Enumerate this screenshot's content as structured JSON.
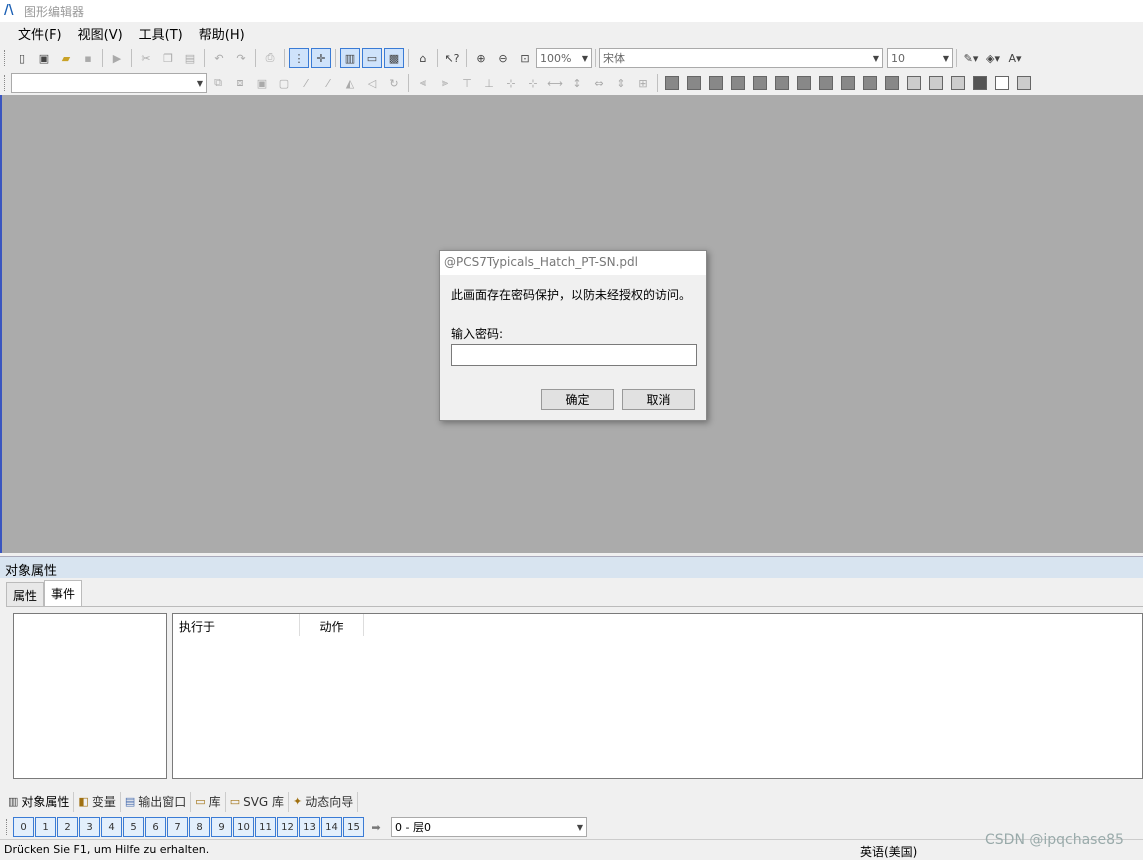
{
  "window": {
    "title": "图形编辑器"
  },
  "menu": [
    "文件(F)",
    "视图(V)",
    "工具(T)",
    "帮助(H)"
  ],
  "toolbar1": {
    "zoom": "100%",
    "font": "宋体",
    "font_size": "10"
  },
  "dialog": {
    "title": "@PCS7Typicals_Hatch_PT-SN.pdl",
    "message": "此画面存在密码保护，以防未经授权的访问。",
    "label": "输入密码:",
    "ok": "确定",
    "cancel": "取消",
    "password_value": ""
  },
  "props_panel": {
    "title": "对象属性",
    "tabs": [
      "属性",
      "事件"
    ],
    "columns": [
      "执行于",
      "动作"
    ]
  },
  "bottom_tabs": [
    "对象属性",
    "变量",
    "输出窗口",
    "库",
    "SVG 库",
    "动态向导"
  ],
  "layers": [
    "0",
    "1",
    "2",
    "3",
    "4",
    "5",
    "6",
    "7",
    "8",
    "9",
    "10",
    "11",
    "12",
    "13",
    "14",
    "15"
  ],
  "layer_select": "0 - 层0",
  "status": {
    "text": "Drücken Sie F1, um Hilfe zu erhalten.",
    "lang": "英语(美国)"
  },
  "watermark": "CSDN @ipqchase85"
}
